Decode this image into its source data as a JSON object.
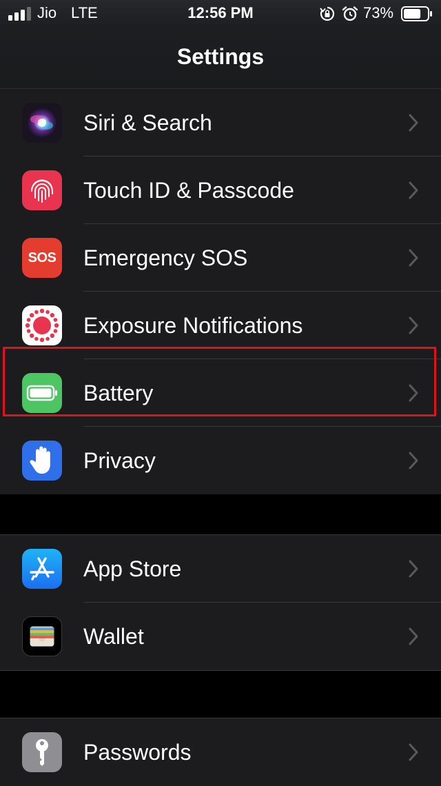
{
  "status_bar": {
    "carrier": "Jio",
    "network": "LTE",
    "time": "12:56 PM",
    "battery_percent": "73%",
    "signal_bars": 3,
    "signal_total": 4,
    "battery_level": 0.73
  },
  "nav": {
    "title": "Settings"
  },
  "groups": [
    {
      "items": [
        {
          "label": "Siri & Search",
          "icon": "siri-icon"
        },
        {
          "label": "Touch ID & Passcode",
          "icon": "fingerprint-icon"
        },
        {
          "label": "Emergency SOS",
          "icon": "sos-icon",
          "icon_text": "SOS"
        },
        {
          "label": "Exposure Notifications",
          "icon": "exposure-icon"
        },
        {
          "label": "Battery",
          "icon": "battery-icon",
          "highlighted": true
        },
        {
          "label": "Privacy",
          "icon": "hand-icon"
        }
      ]
    },
    {
      "items": [
        {
          "label": "App Store",
          "icon": "app-store-icon"
        },
        {
          "label": "Wallet",
          "icon": "wallet-icon"
        }
      ]
    },
    {
      "items": [
        {
          "label": "Passwords",
          "icon": "key-icon"
        }
      ]
    }
  ],
  "colors": {
    "highlight": "#e0131d",
    "cell_background": "#1c1c1e",
    "separator": "#38383a",
    "chevron": "#5a5a5e"
  }
}
